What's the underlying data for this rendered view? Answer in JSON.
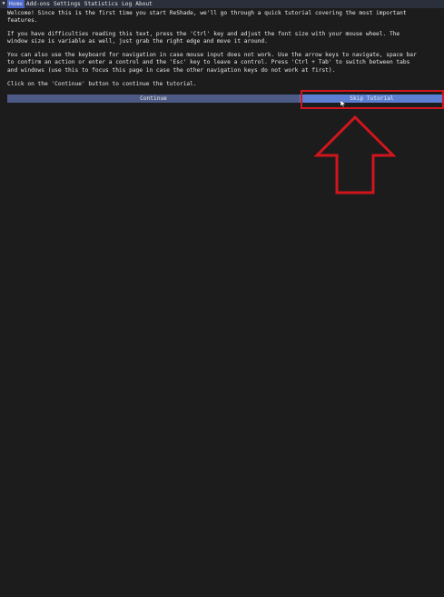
{
  "tabs": [
    {
      "label": "Home",
      "active": true
    },
    {
      "label": "Add-ons",
      "active": false
    },
    {
      "label": "Settings",
      "active": false
    },
    {
      "label": "Statistics",
      "active": false
    },
    {
      "label": "Log",
      "active": false
    },
    {
      "label": "About",
      "active": false
    }
  ],
  "collapse_glyph": "▼",
  "paragraphs": [
    "Welcome! Since this is the first time you start ReShade, we'll go through a quick tutorial covering the most important\nfeatures.",
    "If you have difficulties reading this text, press the 'Ctrl' key and adjust the font size with your mouse wheel. The\nwindow size is variable as well, just grab the right edge and move it around.",
    "You can also use the keyboard for navigation in case mouse input does not work. Use the arrow keys to navigate, space bar\nto confirm an action or enter a control and the 'Esc' key to leave a control. Press 'Ctrl + Tab' to switch between tabs\nand windows (use this to focus this page in case the other navigation keys do not work at first).",
    "Click on the 'Continue' button to continue the tutorial."
  ],
  "buttons": {
    "continue_label": "Continue",
    "skip_label": "Skip Tutorial"
  },
  "colors": {
    "window_bg": "#1c1c1c",
    "tab_active": "#4a64c7",
    "continue_button": "#4d5a85",
    "skip_button": "#5c7fd4",
    "annotation_red": "#d0161c"
  },
  "icons": [
    "collapse-arrow-icon",
    "mouse-cursor-icon",
    "up-arrow-annotation-icon"
  ]
}
